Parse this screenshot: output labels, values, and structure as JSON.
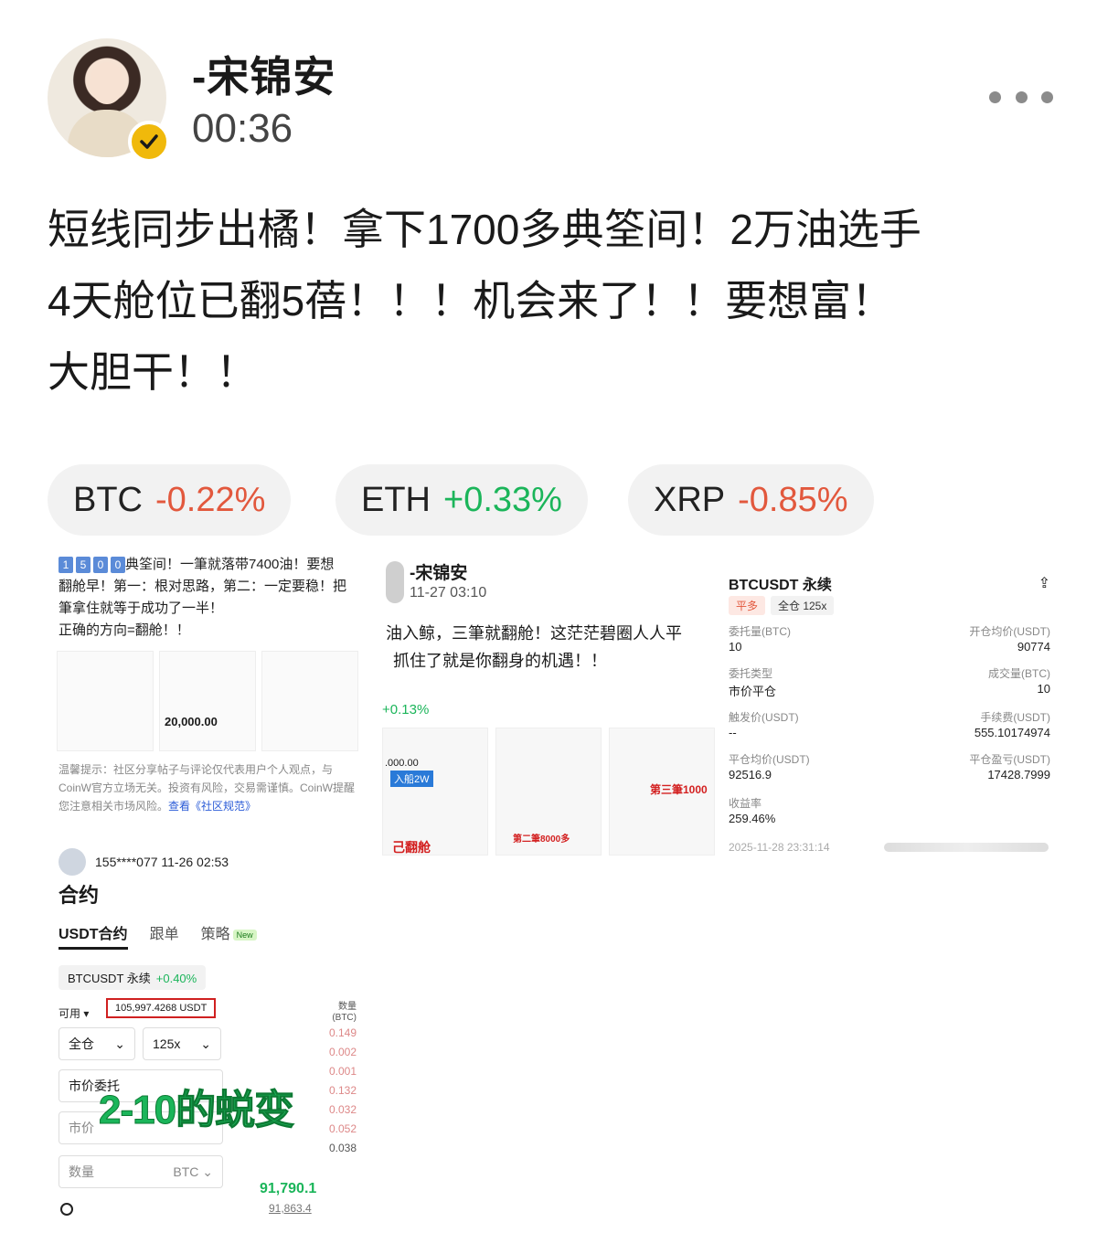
{
  "header": {
    "username": "-宋锦安",
    "time": "00:36"
  },
  "post": {
    "line1": "短线同步出橘！拿下1700多典筌间！2万油选手",
    "line2": "4天舱位已翻5蓓！！！机会来了！！要想富！",
    "line3": "大胆干！！"
  },
  "tickers": [
    {
      "symbol": "BTC",
      "change": "-0.22%"
    },
    {
      "symbol": "ETH",
      "change": "+0.33%"
    },
    {
      "symbol": "XRP",
      "change": "-0.85%"
    }
  ],
  "tile1": {
    "badges": [
      "1",
      "5",
      "0",
      "0"
    ],
    "line1_rest": "典筌间！一筆就落带7400油！要想",
    "line2": "翻舱早！第一：根对思路，第二：一定要稳！把",
    "line3": "筆拿住就等于成功了一半！",
    "line4": "正确的方向=翻舱！！",
    "amount": "20,000.00",
    "warning": "温馨提示：社区分享帖子与评论仅代表用户个人观点，与CoinW官方立场无关。投资有风险，交易需谨慎。CoinW提醒您注意相关市场风险。",
    "link": "查看《社区规范》"
  },
  "tile2": {
    "username": "-宋锦安",
    "time": "11-27 03:10",
    "line1": "油入鲸，三筆就翻舱！这茫茫碧圈人人平",
    "line2": "抓住了就是你翻身的机遇！！",
    "pct": "+0.13%",
    "amount": ".000.00",
    "tag1": "入船2W",
    "tag2": "己翻舱",
    "tag3": "第二筆8000多",
    "tag4": "第三筆1000"
  },
  "tile3": {
    "title": "BTCUSDT 永续",
    "tag_close": "平多",
    "tag_margin": "全仓 125x",
    "fields": [
      {
        "label": "委托量(BTC)",
        "value": "10"
      },
      {
        "label": "开仓均价(USDT)",
        "value": "90774"
      },
      {
        "label": "委托类型",
        "value": "市价平仓"
      },
      {
        "label": "成交量(BTC)",
        "value": "10"
      },
      {
        "label": "触发价(USDT)",
        "value": "--"
      },
      {
        "label": "手续费(USDT)",
        "value": "555.10174974"
      },
      {
        "label": "平仓均价(USDT)",
        "value": "92516.9"
      },
      {
        "label": "平仓盈亏(USDT)",
        "value": "17428.7999"
      },
      {
        "label": "收益率",
        "value": "259.46%"
      }
    ],
    "timestamp": "2025-11-28 23:31:14"
  },
  "tile4": {
    "user": "155****077 11-26 02:53",
    "page_title": "合约",
    "tabs": [
      "USDT合约",
      "跟单",
      "策略"
    ],
    "new_badge": "New",
    "pair": "BTCUSDT 永续",
    "pair_change": "+0.40%",
    "available_label": "可用",
    "balance": "105,997.4268 USDT",
    "margin_mode": "全仓",
    "leverage": "125x",
    "order_type": "市价委托",
    "price_field": "市价",
    "qty_field": "数量",
    "qty_unit": "BTC",
    "overlay": "2-10的蜕变",
    "book_header": "数量\n(BTC)",
    "book": [
      "0.149",
      "0.002",
      "0.001",
      "0.132",
      "0.032",
      "0.052",
      "0.038"
    ],
    "last_price": "91,790.1",
    "mark_price": "91,863.4"
  }
}
